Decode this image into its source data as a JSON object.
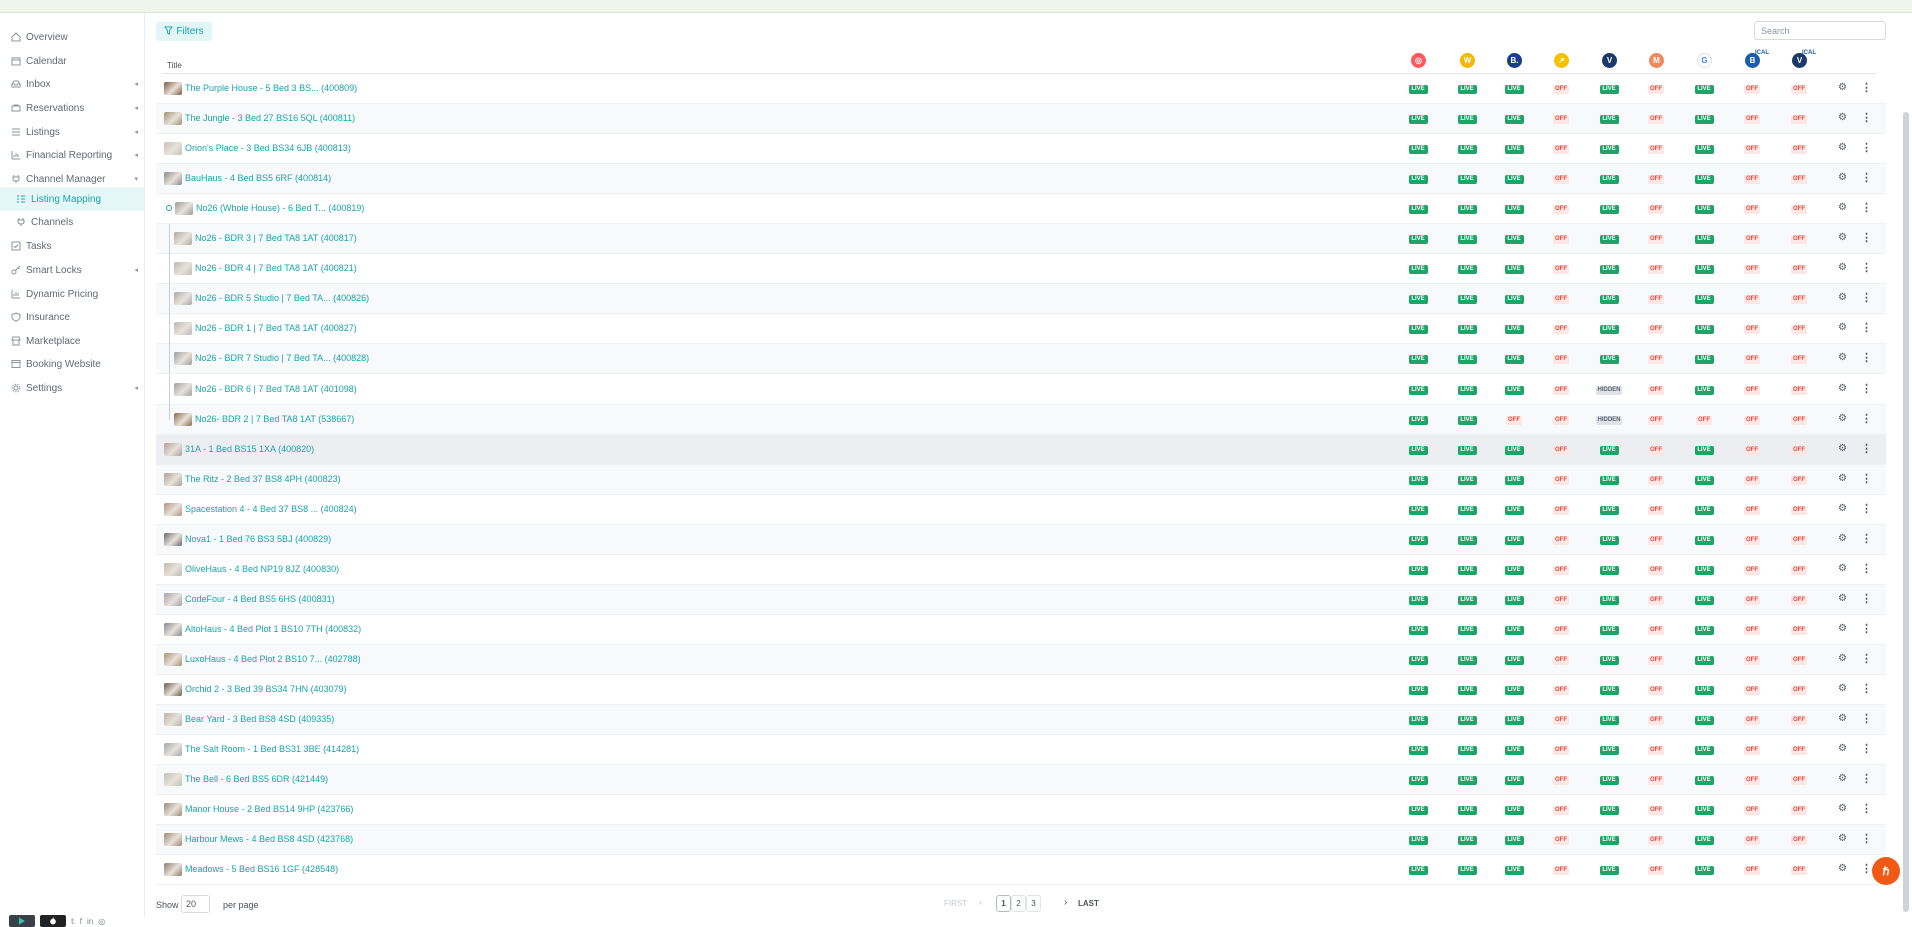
{
  "sidebar": {
    "items": [
      {
        "label": "Overview",
        "icon": "home-icon",
        "caret": false
      },
      {
        "label": "Calendar",
        "icon": "calendar-icon",
        "caret": false
      },
      {
        "label": "Inbox",
        "icon": "inbox-icon",
        "caret": true
      },
      {
        "label": "Reservations",
        "icon": "reservations-icon",
        "caret": true
      },
      {
        "label": "Listings",
        "icon": "list-icon",
        "caret": true
      },
      {
        "label": "Financial Reporting",
        "icon": "chart-icon",
        "caret": true
      },
      {
        "label": "Channel Manager",
        "icon": "plug-icon",
        "caret": true,
        "expanded": true
      },
      {
        "label": "Listing Mapping",
        "icon": "mapping-icon",
        "caret": false,
        "sub": true,
        "active": true
      },
      {
        "label": "Channels",
        "icon": "plug-icon",
        "caret": false,
        "sub": true
      },
      {
        "label": "Tasks",
        "icon": "tasks-icon",
        "caret": false
      },
      {
        "label": "Smart Locks",
        "icon": "key-icon",
        "caret": true
      },
      {
        "label": "Dynamic Pricing",
        "icon": "chart-icon",
        "caret": false
      },
      {
        "label": "Insurance",
        "icon": "shield-icon",
        "caret": false
      },
      {
        "label": "Marketplace",
        "icon": "store-icon",
        "caret": false
      },
      {
        "label": "Booking Website",
        "icon": "browser-icon",
        "caret": false
      },
      {
        "label": "Settings",
        "icon": "gear-icon",
        "caret": true
      }
    ],
    "footer_icons": [
      "google-play-icon",
      "apple-icon",
      "twitter-icon",
      "facebook-icon",
      "linkedin-icon",
      "instagram-icon"
    ]
  },
  "toolbar": {
    "filters_label": "Filters",
    "search_placeholder": "Search"
  },
  "table": {
    "title_header": "Title",
    "channels": [
      {
        "name": "airbnb-icon",
        "color": "#ff5a5f",
        "glyph": "◎"
      },
      {
        "name": "wheelhouse-icon",
        "color": "#f5b800",
        "glyph": "W"
      },
      {
        "name": "booking-icon",
        "color": "#1a3c8c",
        "glyph": "B."
      },
      {
        "name": "expedia-icon",
        "color": "#f5c200",
        "glyph": "↗"
      },
      {
        "name": "vrbo-icon",
        "color": "#1b3a6b",
        "glyph": "V"
      },
      {
        "name": "marriott-icon",
        "color": "#f08a5d",
        "glyph": "M"
      },
      {
        "name": "google-icon",
        "color": "#ffffff",
        "glyph": "G"
      },
      {
        "name": "booking-ical-icon",
        "color": "#1a5da8",
        "glyph": "B",
        "ical": "ICAL"
      },
      {
        "name": "vrbo-ical-icon",
        "color": "#1b3a6b",
        "glyph": "V",
        "ical": "ICAL"
      }
    ],
    "rows": [
      {
        "title": "The Purple House - 5 Bed 3 BS...  (400809)",
        "level": 0,
        "thumb": "#7a5a3c",
        "statuses": [
          "LIVE",
          "LIVE",
          "LIVE",
          "OFF",
          "LIVE",
          "OFF",
          "LIVE",
          "OFF",
          "OFF"
        ]
      },
      {
        "title": "The Jungle - 3 Bed 27 BS16 5QL (400811)",
        "level": 0,
        "thumb": "#a09070",
        "statuses": [
          "LIVE",
          "LIVE",
          "LIVE",
          "OFF",
          "LIVE",
          "OFF",
          "LIVE",
          "OFF",
          "OFF"
        ]
      },
      {
        "title": "Orion's Place - 3 Bed BS34 6JB (400813)",
        "level": 0,
        "thumb": "#c8c0b8",
        "statuses": [
          "LIVE",
          "LIVE",
          "LIVE",
          "OFF",
          "LIVE",
          "OFF",
          "LIVE",
          "OFF",
          "OFF"
        ]
      },
      {
        "title": "BauHaus - 4 Bed BS5 6RF (400814)",
        "level": 0,
        "thumb": "#8a8a8a",
        "statuses": [
          "LIVE",
          "LIVE",
          "LIVE",
          "OFF",
          "LIVE",
          "OFF",
          "LIVE",
          "OFF",
          "OFF"
        ]
      },
      {
        "title": "No26 (Whole House) - 6 Bed T...   (400819)",
        "level": 0,
        "parent": true,
        "thumb": "#9a9a9a",
        "statuses": [
          "LIVE",
          "LIVE",
          "LIVE",
          "OFF",
          "LIVE",
          "OFF",
          "LIVE",
          "OFF",
          "OFF"
        ]
      },
      {
        "title": "No26 - BDR 3 | 7 Bed TA8 1AT (400817)",
        "level": 1,
        "thumb": "#b0a8a0",
        "statuses": [
          "LIVE",
          "LIVE",
          "LIVE",
          "OFF",
          "LIVE",
          "OFF",
          "LIVE",
          "OFF",
          "OFF"
        ]
      },
      {
        "title": "No26 - BDR 4 | 7 Bed TA8 1AT (400821)",
        "level": 1,
        "thumb": "#c0b8b0",
        "statuses": [
          "LIVE",
          "LIVE",
          "LIVE",
          "OFF",
          "LIVE",
          "OFF",
          "LIVE",
          "OFF",
          "OFF"
        ]
      },
      {
        "title": "No26 - BDR 5 Studio | 7 Bed TA...  (400826)",
        "level": 1,
        "thumb": "#a8a8a8",
        "statuses": [
          "LIVE",
          "LIVE",
          "LIVE",
          "OFF",
          "LIVE",
          "OFF",
          "LIVE",
          "OFF",
          "OFF"
        ]
      },
      {
        "title": "No26 - BDR 1 | 7 Bed TA8 1AT (400827)",
        "level": 1,
        "thumb": "#b8b8b8",
        "statuses": [
          "LIVE",
          "LIVE",
          "LIVE",
          "OFF",
          "LIVE",
          "OFF",
          "LIVE",
          "OFF",
          "OFF"
        ]
      },
      {
        "title": "No26 - BDR 7 Studio | 7 Bed TA...  (400828)",
        "level": 1,
        "thumb": "#9c9c9c",
        "statuses": [
          "LIVE",
          "LIVE",
          "LIVE",
          "OFF",
          "LIVE",
          "OFF",
          "LIVE",
          "OFF",
          "OFF"
        ]
      },
      {
        "title": "No26 - BDR 6 | 7 Bed TA8 1AT (401098)",
        "level": 1,
        "thumb": "#a0a0a0",
        "statuses": [
          "LIVE",
          "LIVE",
          "LIVE",
          "OFF",
          "HIDDEN",
          "OFF",
          "LIVE",
          "OFF",
          "OFF"
        ]
      },
      {
        "title": "No26- BDR 2 | 7 Bed TA8 1AT (538667)",
        "level": 1,
        "last_child": true,
        "thumb": "#8a6a4a",
        "statuses": [
          "LIVE",
          "LIVE",
          "OFF",
          "OFF",
          "HIDDEN",
          "OFF",
          "OFF",
          "OFF",
          "OFF"
        ]
      },
      {
        "title": "31A - 1 Bed BS15 1XA (400820)",
        "level": 0,
        "highlight": true,
        "thumb": "#b0a098",
        "statuses": [
          "LIVE",
          "LIVE",
          "LIVE",
          "OFF",
          "LIVE",
          "OFF",
          "LIVE",
          "OFF",
          "OFF"
        ]
      },
      {
        "title": "The Ritz - 2 Bed 37 BS8 4PH (400823)",
        "level": 0,
        "thumb": "#a8a098",
        "statuses": [
          "LIVE",
          "LIVE",
          "LIVE",
          "OFF",
          "LIVE",
          "OFF",
          "LIVE",
          "OFF",
          "OFF"
        ]
      },
      {
        "title": "Spacestation 4 - 4 Bed 37 BS8 ...  (400824)",
        "level": 0,
        "thumb": "#b09080",
        "statuses": [
          "LIVE",
          "LIVE",
          "LIVE",
          "OFF",
          "LIVE",
          "OFF",
          "LIVE",
          "OFF",
          "OFF"
        ]
      },
      {
        "title": "Nova1 - 1 Bed 76 BS3 5BJ (400829)",
        "level": 0,
        "thumb": "#6a6a70",
        "statuses": [
          "LIVE",
          "LIVE",
          "LIVE",
          "OFF",
          "LIVE",
          "OFF",
          "LIVE",
          "OFF",
          "OFF"
        ]
      },
      {
        "title": "OliveHaus - 4 Bed NP19 8JZ (400830)",
        "level": 0,
        "thumb": "#c0b8a8",
        "statuses": [
          "LIVE",
          "LIVE",
          "LIVE",
          "OFF",
          "LIVE",
          "OFF",
          "LIVE",
          "OFF",
          "OFF"
        ]
      },
      {
        "title": "CodeFour - 4 Bed BS5 6HS (400831)",
        "level": 0,
        "thumb": "#a0a0a8",
        "statuses": [
          "LIVE",
          "LIVE",
          "LIVE",
          "OFF",
          "LIVE",
          "OFF",
          "LIVE",
          "OFF",
          "OFF"
        ]
      },
      {
        "title": "AltoHaus - 4 Bed Plot 1 BS10 7TH (400832)",
        "level": 0,
        "thumb": "#808890",
        "statuses": [
          "LIVE",
          "LIVE",
          "LIVE",
          "OFF",
          "LIVE",
          "OFF",
          "LIVE",
          "OFF",
          "OFF"
        ]
      },
      {
        "title": "LuxoHaus - 4 Bed Plot 2 BS10 7...  (402788)",
        "level": 0,
        "thumb": "#a89070",
        "statuses": [
          "LIVE",
          "LIVE",
          "LIVE",
          "OFF",
          "LIVE",
          "OFF",
          "LIVE",
          "OFF",
          "OFF"
        ]
      },
      {
        "title": "Orchid 2 - 3 Bed 39 BS34 7HN (403079)",
        "level": 0,
        "thumb": "#6a5a4a",
        "statuses": [
          "LIVE",
          "LIVE",
          "LIVE",
          "OFF",
          "LIVE",
          "OFF",
          "LIVE",
          "OFF",
          "OFF"
        ]
      },
      {
        "title": "Bear Yard - 3 Bed BS8 4SD (409335)",
        "level": 0,
        "thumb": "#b8b0a8",
        "statuses": [
          "LIVE",
          "LIVE",
          "LIVE",
          "OFF",
          "LIVE",
          "OFF",
          "LIVE",
          "OFF",
          "OFF"
        ]
      },
      {
        "title": "The Salt Room - 1 Bed BS31 3BE (414281)",
        "level": 0,
        "thumb": "#a0a8a8",
        "statuses": [
          "LIVE",
          "LIVE",
          "LIVE",
          "OFF",
          "LIVE",
          "OFF",
          "LIVE",
          "OFF",
          "OFF"
        ]
      },
      {
        "title": "The Bell - 6 Bed BS5 6DR (421449)",
        "level": 0,
        "thumb": "#c0c0b8",
        "statuses": [
          "LIVE",
          "LIVE",
          "LIVE",
          "OFF",
          "LIVE",
          "OFF",
          "LIVE",
          "OFF",
          "OFF"
        ]
      },
      {
        "title": "Manor House - 2 Bed BS14 9HP (423766)",
        "level": 0,
        "thumb": "#9a8878",
        "statuses": [
          "LIVE",
          "LIVE",
          "LIVE",
          "OFF",
          "LIVE",
          "OFF",
          "LIVE",
          "OFF",
          "OFF"
        ]
      },
      {
        "title": "Harbour Mews - 4 Bed BS8 4SD (423768)",
        "level": 0,
        "thumb": "#a08870",
        "statuses": [
          "LIVE",
          "LIVE",
          "LIVE",
          "OFF",
          "LIVE",
          "OFF",
          "LIVE",
          "OFF",
          "OFF"
        ]
      },
      {
        "title": "Meadows - 5 Bed BS16 1GF (428548)",
        "level": 0,
        "thumb": "#8a7a6a",
        "statuses": [
          "LIVE",
          "LIVE",
          "LIVE",
          "OFF",
          "LIVE",
          "OFF",
          "LIVE",
          "OFF",
          "OFF"
        ]
      }
    ]
  },
  "footer": {
    "show_label": "Show",
    "per_page_value": "20",
    "per_page_label": "per page",
    "first_label": "FIRST",
    "prev_glyph": "‹",
    "pages": [
      "1",
      "2",
      "3"
    ],
    "current_page": "1",
    "next_glyph": "›",
    "last_label": "LAST"
  },
  "fab_glyph": "ℏ"
}
